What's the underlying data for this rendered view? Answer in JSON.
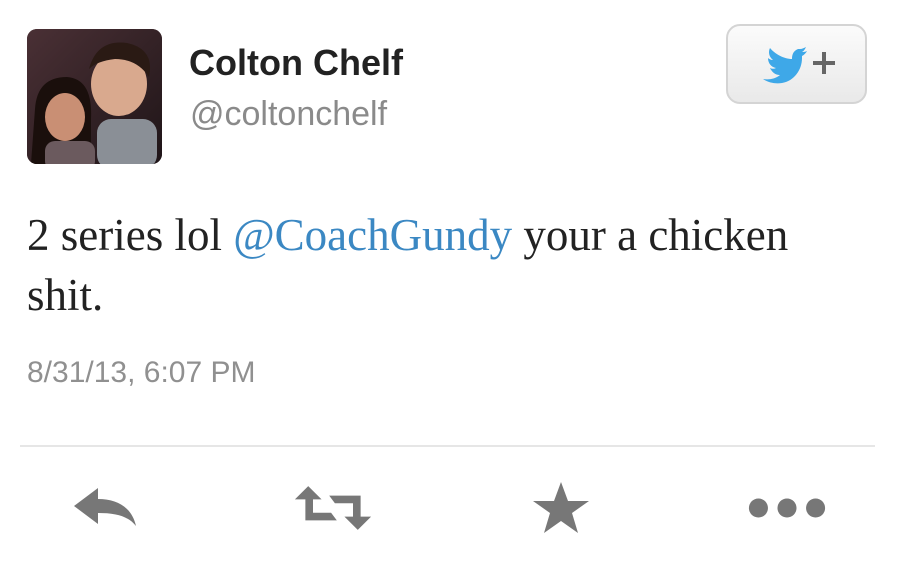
{
  "tweet": {
    "author_name": "Colton Chelf",
    "author_handle": "@coltonchelf",
    "text_before": "2 series lol ",
    "mention": "@CoachGundy",
    "text_after": " your a chicken shit.",
    "timestamp": "8/31/13, 6:07 PM"
  },
  "icons": {
    "follow": "twitter-bird-plus-icon",
    "reply": "reply-arrow-icon",
    "retweet": "retweet-icon",
    "favorite": "star-icon",
    "more": "more-dots-icon"
  },
  "colors": {
    "mention": "#3b88c3",
    "bird": "#3ea8e8",
    "icon_gray": "#777777"
  }
}
